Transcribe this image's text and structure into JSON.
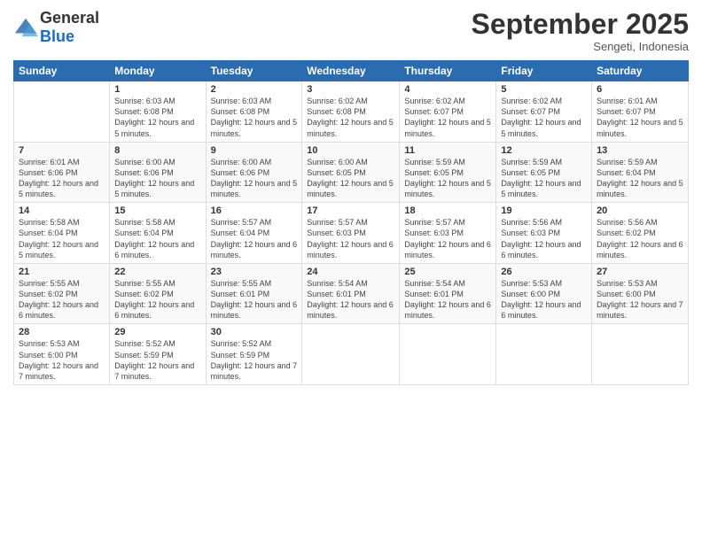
{
  "logo": {
    "general": "General",
    "blue": "Blue"
  },
  "title": "September 2025",
  "subtitle": "Sengeti, Indonesia",
  "days_of_week": [
    "Sunday",
    "Monday",
    "Tuesday",
    "Wednesday",
    "Thursday",
    "Friday",
    "Saturday"
  ],
  "weeks": [
    [
      {
        "day": "",
        "info": ""
      },
      {
        "day": "1",
        "info": "Sunrise: 6:03 AM\nSunset: 6:08 PM\nDaylight: 12 hours\nand 5 minutes."
      },
      {
        "day": "2",
        "info": "Sunrise: 6:03 AM\nSunset: 6:08 PM\nDaylight: 12 hours\nand 5 minutes."
      },
      {
        "day": "3",
        "info": "Sunrise: 6:02 AM\nSunset: 6:08 PM\nDaylight: 12 hours\nand 5 minutes."
      },
      {
        "day": "4",
        "info": "Sunrise: 6:02 AM\nSunset: 6:07 PM\nDaylight: 12 hours\nand 5 minutes."
      },
      {
        "day": "5",
        "info": "Sunrise: 6:02 AM\nSunset: 6:07 PM\nDaylight: 12 hours\nand 5 minutes."
      },
      {
        "day": "6",
        "info": "Sunrise: 6:01 AM\nSunset: 6:07 PM\nDaylight: 12 hours\nand 5 minutes."
      }
    ],
    [
      {
        "day": "7",
        "info": "Sunrise: 6:01 AM\nSunset: 6:06 PM\nDaylight: 12 hours\nand 5 minutes."
      },
      {
        "day": "8",
        "info": "Sunrise: 6:00 AM\nSunset: 6:06 PM\nDaylight: 12 hours\nand 5 minutes."
      },
      {
        "day": "9",
        "info": "Sunrise: 6:00 AM\nSunset: 6:06 PM\nDaylight: 12 hours\nand 5 minutes."
      },
      {
        "day": "10",
        "info": "Sunrise: 6:00 AM\nSunset: 6:05 PM\nDaylight: 12 hours\nand 5 minutes."
      },
      {
        "day": "11",
        "info": "Sunrise: 5:59 AM\nSunset: 6:05 PM\nDaylight: 12 hours\nand 5 minutes."
      },
      {
        "day": "12",
        "info": "Sunrise: 5:59 AM\nSunset: 6:05 PM\nDaylight: 12 hours\nand 5 minutes."
      },
      {
        "day": "13",
        "info": "Sunrise: 5:59 AM\nSunset: 6:04 PM\nDaylight: 12 hours\nand 5 minutes."
      }
    ],
    [
      {
        "day": "14",
        "info": "Sunrise: 5:58 AM\nSunset: 6:04 PM\nDaylight: 12 hours\nand 5 minutes."
      },
      {
        "day": "15",
        "info": "Sunrise: 5:58 AM\nSunset: 6:04 PM\nDaylight: 12 hours\nand 6 minutes."
      },
      {
        "day": "16",
        "info": "Sunrise: 5:57 AM\nSunset: 6:04 PM\nDaylight: 12 hours\nand 6 minutes."
      },
      {
        "day": "17",
        "info": "Sunrise: 5:57 AM\nSunset: 6:03 PM\nDaylight: 12 hours\nand 6 minutes."
      },
      {
        "day": "18",
        "info": "Sunrise: 5:57 AM\nSunset: 6:03 PM\nDaylight: 12 hours\nand 6 minutes."
      },
      {
        "day": "19",
        "info": "Sunrise: 5:56 AM\nSunset: 6:03 PM\nDaylight: 12 hours\nand 6 minutes."
      },
      {
        "day": "20",
        "info": "Sunrise: 5:56 AM\nSunset: 6:02 PM\nDaylight: 12 hours\nand 6 minutes."
      }
    ],
    [
      {
        "day": "21",
        "info": "Sunrise: 5:55 AM\nSunset: 6:02 PM\nDaylight: 12 hours\nand 6 minutes."
      },
      {
        "day": "22",
        "info": "Sunrise: 5:55 AM\nSunset: 6:02 PM\nDaylight: 12 hours\nand 6 minutes."
      },
      {
        "day": "23",
        "info": "Sunrise: 5:55 AM\nSunset: 6:01 PM\nDaylight: 12 hours\nand 6 minutes."
      },
      {
        "day": "24",
        "info": "Sunrise: 5:54 AM\nSunset: 6:01 PM\nDaylight: 12 hours\nand 6 minutes."
      },
      {
        "day": "25",
        "info": "Sunrise: 5:54 AM\nSunset: 6:01 PM\nDaylight: 12 hours\nand 6 minutes."
      },
      {
        "day": "26",
        "info": "Sunrise: 5:53 AM\nSunset: 6:00 PM\nDaylight: 12 hours\nand 6 minutes."
      },
      {
        "day": "27",
        "info": "Sunrise: 5:53 AM\nSunset: 6:00 PM\nDaylight: 12 hours\nand 7 minutes."
      }
    ],
    [
      {
        "day": "28",
        "info": "Sunrise: 5:53 AM\nSunset: 6:00 PM\nDaylight: 12 hours\nand 7 minutes."
      },
      {
        "day": "29",
        "info": "Sunrise: 5:52 AM\nSunset: 5:59 PM\nDaylight: 12 hours\nand 7 minutes."
      },
      {
        "day": "30",
        "info": "Sunrise: 5:52 AM\nSunset: 5:59 PM\nDaylight: 12 hours\nand 7 minutes."
      },
      {
        "day": "",
        "info": ""
      },
      {
        "day": "",
        "info": ""
      },
      {
        "day": "",
        "info": ""
      },
      {
        "day": "",
        "info": ""
      }
    ]
  ]
}
